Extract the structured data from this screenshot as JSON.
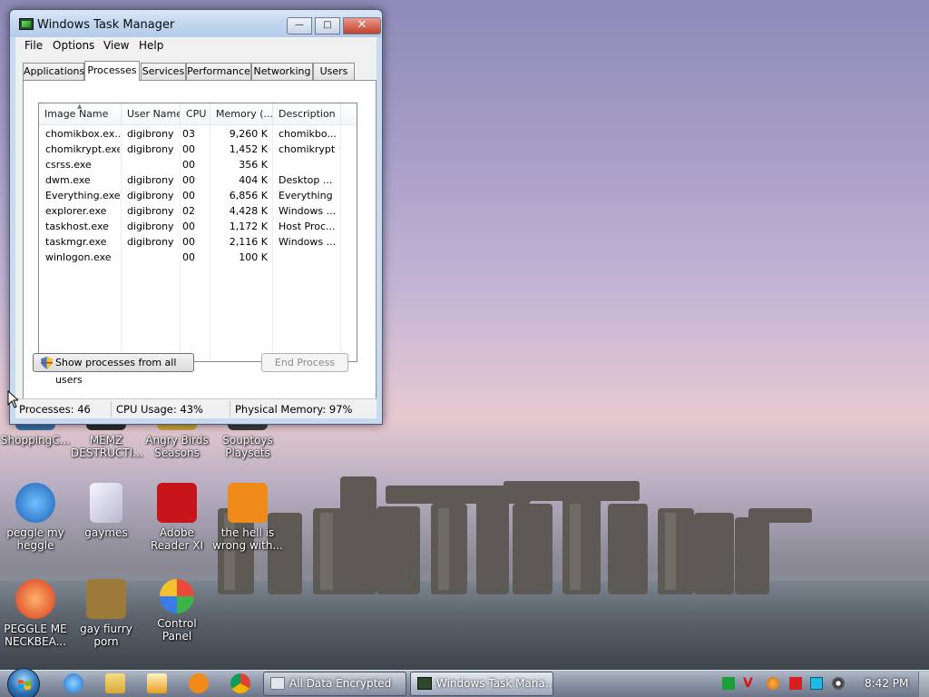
{
  "window": {
    "title": "Windows Task Manager",
    "min_label": "—",
    "max_label": "□",
    "close_label": "✕"
  },
  "menu": [
    "File",
    "Options",
    "View",
    "Help"
  ],
  "tabs": [
    "Applications",
    "Processes",
    "Services",
    "Performance",
    "Networking",
    "Users"
  ],
  "active_tab": "Processes",
  "process_table": {
    "columns": [
      "Image Name",
      "User Name",
      "CPU",
      "Memory (...",
      "Description"
    ],
    "rows": [
      [
        "chomikbox.ex...",
        "digibrony",
        "03",
        "9,260 K",
        "chomikbo..."
      ],
      [
        "chomikrypt.exe",
        "digibrony",
        "00",
        "1,452 K",
        "chomikrypt"
      ],
      [
        "csrss.exe",
        "",
        "00",
        "356 K",
        ""
      ],
      [
        "dwm.exe",
        "digibrony",
        "00",
        "404 K",
        "Desktop ..."
      ],
      [
        "Everything.exe",
        "digibrony",
        "00",
        "6,856 K",
        "Everything"
      ],
      [
        "explorer.exe",
        "digibrony",
        "02",
        "4,428 K",
        "Windows ..."
      ],
      [
        "taskhost.exe",
        "digibrony",
        "00",
        "1,172 K",
        "Host Proc..."
      ],
      [
        "taskmgr.exe",
        "digibrony",
        "00",
        "2,116 K",
        "Windows ..."
      ],
      [
        "winlogon.exe",
        "",
        "00",
        "100 K",
        ""
      ]
    ]
  },
  "buttons": {
    "show_all": "Show processes from all users",
    "end_process": "End Process"
  },
  "status": {
    "processes": "Processes: 46",
    "cpu": "CPU Usage: 43%",
    "memory": "Physical Memory: 97%"
  },
  "desktop_icons": [
    {
      "label": "ShoppingC...",
      "color": "#3b6fa8"
    },
    {
      "label": "MEMZ DESTRUCTI...",
      "color": "#2b2b2b"
    },
    {
      "label": "Angry Birds Seasons",
      "color": "#c8a23a"
    },
    {
      "label": "Souptoys Playsets",
      "color": "#3a3a3a"
    },
    {
      "label": "peggle my heggle",
      "color": "#2a7bd6"
    },
    {
      "label": "gaymes",
      "color": "#d9d9e8"
    },
    {
      "label": "Adobe Reader XI",
      "color": "#c8141b"
    },
    {
      "label": "the hell is wrong with...",
      "color": "#f08a18"
    },
    {
      "label": "PEGGLE ME NECKBEA...",
      "color": "#e0402c"
    },
    {
      "label": "gay fiurry porn",
      "color": "#9c7a3a"
    },
    {
      "label": "Control Panel",
      "color": "#4a8ad0"
    }
  ],
  "taskbar": {
    "tasks": [
      "All Data Encrypted",
      "Windows Task Mana..."
    ],
    "clock": "8:42 PM"
  }
}
